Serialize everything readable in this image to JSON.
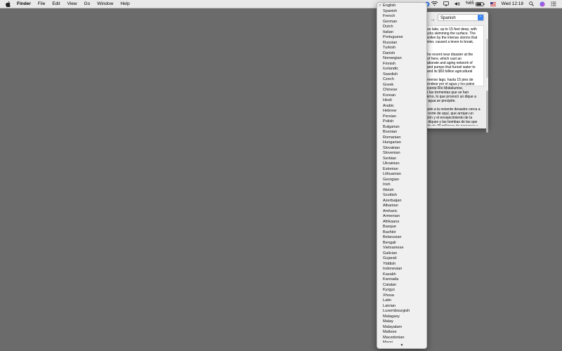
{
  "menubar": {
    "app_name": "Finder",
    "menus": [
      "File",
      "Edit",
      "View",
      "Go",
      "Window",
      "Help"
    ],
    "battery_percent": "%65",
    "clock": "Wed 12:18"
  },
  "translator": {
    "target_language": "Spanish",
    "source_text": [
      "...se lake, up to 15 feet deep, with\nducks skimming the surface. The\nswollen by the intense storms that\nwinter, caused a levee to break,\n...",
      "...he recent near disaster at the\nh of here, which cast an\nelaborate and aging network of\ns and pumps that funnel water to\ns and its $50 billion agricultural"
    ],
    "translated_text": [
      "...menso lago, hasta 15 pies de\nmendear por el agua y los patos\nsecente Río Mokelumne,\nde las tormentas que se han\nvierno, lo que provocó un dique a\nel agua se precipite.",
      "...ado a la reciente desastre cerca a\nal norte de aquí, que arrojan un\nación y el envejecimiento de la\ns, diques y las bombas de las que\ntado de 39 millones de personas y"
    ]
  },
  "language_menu": {
    "selected": "English",
    "items": [
      "English",
      "Spanish",
      "French",
      "German",
      "Dutch",
      "Italian",
      "Portuguese",
      "Russian",
      "Turkish",
      "Danish",
      "Norwegian",
      "Finnish",
      "Icelandic",
      "Swedish",
      "Czech",
      "Greek",
      "Chinese",
      "Korean",
      "Hindi",
      "Arabic",
      "Hebrew",
      "Persian",
      "Polish",
      "Bulgarian",
      "Bosnian",
      "Romanian",
      "Hungarian",
      "Slovakian",
      "Slovenian",
      "Serbian",
      "Ukrainian",
      "Estonian",
      "Lithuanian",
      "Georgian",
      "Irish",
      "Welsh",
      "Scottish",
      "Azerbaijan",
      "Albanian",
      "Amharic",
      "Armenian",
      "Afrikaans",
      "Basque",
      "Bashkir",
      "Belarusian",
      "Bengali",
      "Vietnamese",
      "Galician",
      "Gujarati",
      "Yiddish",
      "Indonesian",
      "Kazakh",
      "Kannada",
      "Catalan",
      "Kyrgyz",
      "Xhosa",
      "Latin",
      "Latvian",
      "Luxembourgish",
      "Malagasy",
      "Malay",
      "Malayalam",
      "Maltese",
      "Macedonian",
      "Maori"
    ],
    "scroll_indicator": "▼"
  }
}
